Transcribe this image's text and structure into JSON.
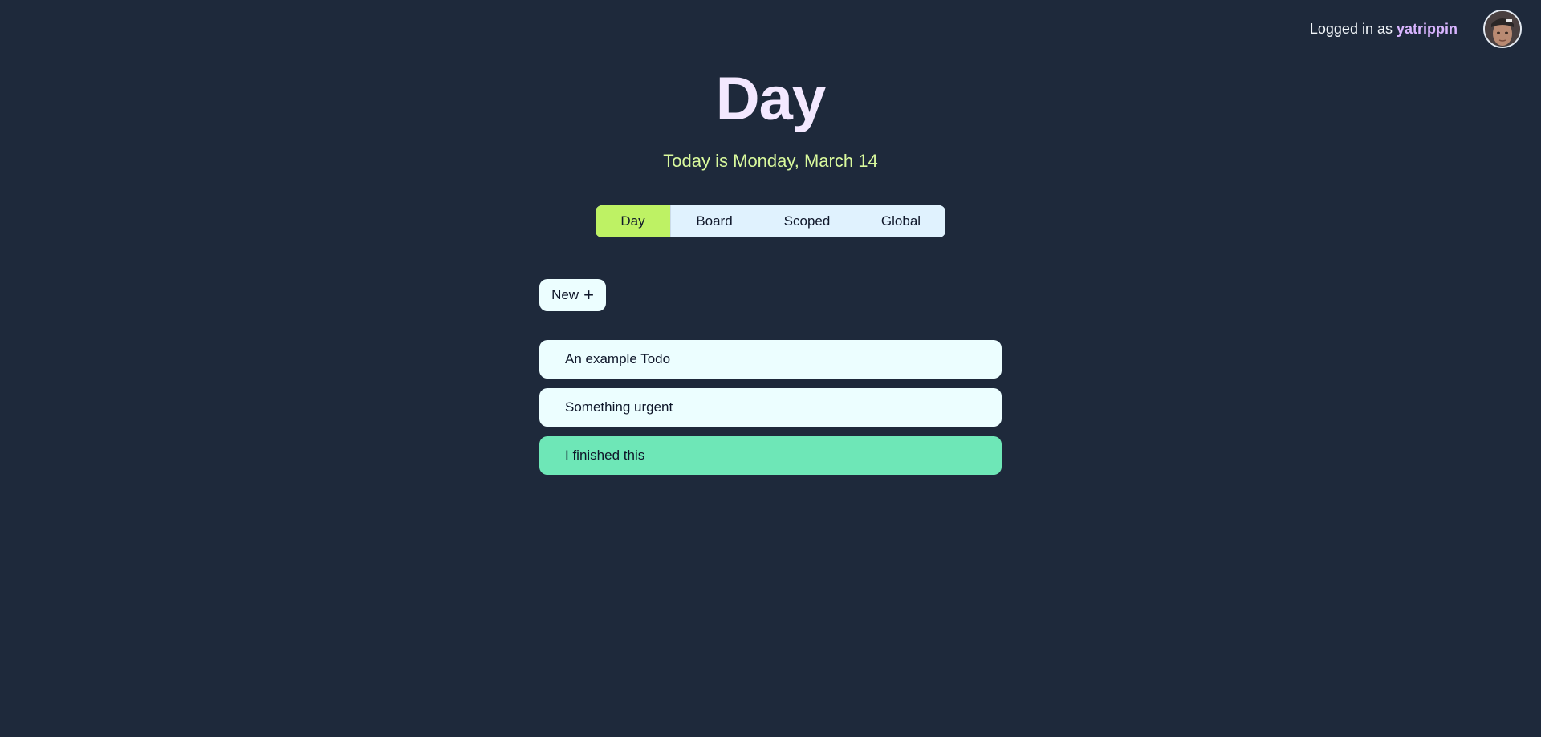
{
  "header": {
    "login_prefix": "Logged in as ",
    "username": "yatrippin"
  },
  "page": {
    "title": "Day",
    "date_text": "Today is Monday, March 14"
  },
  "view_tabs": [
    {
      "label": "Day",
      "active": true
    },
    {
      "label": "Board",
      "active": false
    },
    {
      "label": "Scoped",
      "active": false
    },
    {
      "label": "Global",
      "active": false
    }
  ],
  "new_button": {
    "label": "New",
    "icon": "plus-icon",
    "icon_glyph": "+"
  },
  "todos": [
    {
      "text": "An example Todo",
      "done": false
    },
    {
      "text": "Something urgent",
      "done": false
    },
    {
      "text": "I finished this",
      "done": true
    }
  ],
  "colors": {
    "background": "#1e293b",
    "title": "#f3e8ff",
    "date": "#d9f99d",
    "username": "#d8b4fe",
    "active_tab": "#bef264",
    "tab": "#e0f2fe",
    "todo": "#ecfeff",
    "todo_done": "#6ee7b7"
  }
}
